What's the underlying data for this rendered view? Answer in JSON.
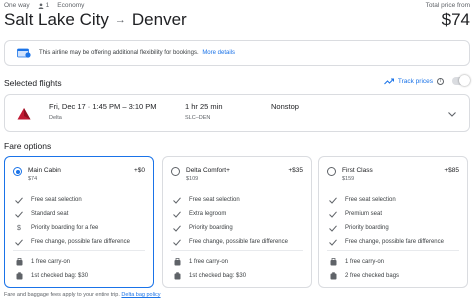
{
  "header": {
    "trip_type": "One way",
    "passengers": "1",
    "cabin": "Economy",
    "origin": "Salt Lake City",
    "destination": "Denver",
    "total_label": "Total price from",
    "total_price": "$74"
  },
  "notice": {
    "text": "This airline may be offering additional flexibility for bookings.",
    "link": "More details"
  },
  "selected": {
    "title": "Selected flights",
    "track_label": "Track prices",
    "flight": {
      "times": "Fri, Dec 17 · 1:45 PM – 3:10 PM",
      "airline": "Delta",
      "duration": "1 hr 25 min",
      "airports": "SLC–DEN",
      "stops": "Nonstop"
    }
  },
  "fares": {
    "title": "Fare options",
    "cards": [
      {
        "name": "Main Cabin",
        "price": "$74",
        "diff": "+$0",
        "selected": true,
        "features": [
          {
            "icon": "check-icon",
            "text": "Free seat selection"
          },
          {
            "icon": "check-icon",
            "text": "Standard seat"
          },
          {
            "icon": "dollar-icon",
            "text": "Priority boarding for a fee"
          },
          {
            "icon": "check-icon",
            "text": "Free change, possible fare difference"
          }
        ],
        "bags": [
          {
            "icon": "carry-on-icon",
            "text": "1 free carry-on"
          },
          {
            "icon": "checked-bag-icon",
            "text": "1st checked bag: $30"
          }
        ]
      },
      {
        "name": "Delta Comfort+",
        "price": "$109",
        "diff": "+$35",
        "selected": false,
        "features": [
          {
            "icon": "check-icon",
            "text": "Free seat selection"
          },
          {
            "icon": "check-icon",
            "text": "Extra legroom"
          },
          {
            "icon": "check-icon",
            "text": "Priority boarding"
          },
          {
            "icon": "check-icon",
            "text": "Free change, possible fare difference"
          }
        ],
        "bags": [
          {
            "icon": "carry-on-icon",
            "text": "1 free carry-on"
          },
          {
            "icon": "checked-bag-icon",
            "text": "1st checked bag: $30"
          }
        ]
      },
      {
        "name": "First Class",
        "price": "$159",
        "diff": "+$85",
        "selected": false,
        "features": [
          {
            "icon": "check-icon",
            "text": "Free seat selection"
          },
          {
            "icon": "check-icon",
            "text": "Premium seat"
          },
          {
            "icon": "check-icon",
            "text": "Priority boarding"
          },
          {
            "icon": "check-icon",
            "text": "Free change, possible fare difference"
          }
        ],
        "bags": [
          {
            "icon": "carry-on-icon",
            "text": "1 free carry-on"
          },
          {
            "icon": "checked-bag-icon",
            "text": "2 free checked bags"
          }
        ]
      }
    ]
  },
  "footer": {
    "text": "Fare and baggage fees apply to your entire trip.",
    "link": "Delta bag policy"
  },
  "colors": {
    "accent": "#1a73e8",
    "delta_red": "#c01933",
    "delta_dark": "#8f1022"
  }
}
